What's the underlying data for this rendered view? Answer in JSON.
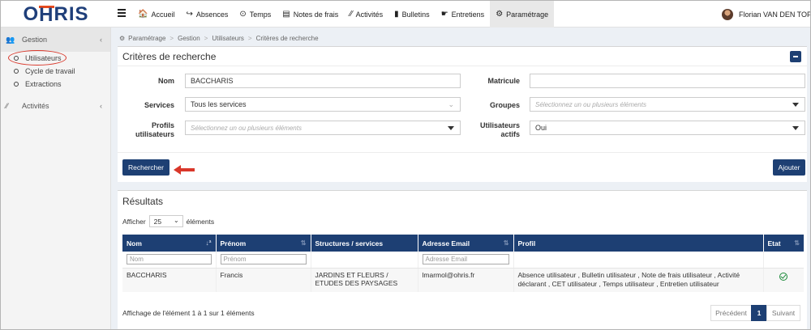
{
  "logo": {
    "part1": "O",
    "part2": "H",
    "part3": "RIS"
  },
  "nav": [
    {
      "icon": "🏠",
      "label": "Accueil"
    },
    {
      "icon": "↪",
      "label": "Absences"
    },
    {
      "icon": "⊙",
      "label": "Temps"
    },
    {
      "icon": "▤",
      "label": "Notes de frais"
    },
    {
      "icon": "⁄⁄",
      "label": "Activités"
    },
    {
      "icon": "▮",
      "label": "Bulletins"
    },
    {
      "icon": "☛",
      "label": "Entretiens"
    },
    {
      "icon": "⚙",
      "label": "Paramétrage"
    }
  ],
  "user": {
    "name": "Florian VAN DEN TOP"
  },
  "sidebar": {
    "gestion": "Gestion",
    "items": [
      "Utilisateurs",
      "Cycle de travail",
      "Extractions"
    ],
    "activites": "Activités"
  },
  "breadcrumb": [
    "Paramétrage",
    "Gestion",
    "Utilisateurs",
    "Critères de recherche"
  ],
  "search": {
    "title": "Critères de recherche",
    "nom_label": "Nom",
    "nom_value": "BACCHARIS",
    "matricule_label": "Matricule",
    "matricule_value": "",
    "services_label": "Services",
    "services_value": "Tous les services",
    "groupes_label": "Groupes",
    "groupes_placeholder": "Sélectionnez un ou plusieurs éléments",
    "profils_label_1": "Profils",
    "profils_label_2": "utilisateurs",
    "profils_placeholder": "Sélectionnez un ou plusieurs éléments",
    "actifs_label_1": "Utilisateurs",
    "actifs_label_2": "actifs",
    "actifs_value": "Oui",
    "search_button": "Rechercher",
    "add_button": "Ajouter"
  },
  "results": {
    "title": "Résultats",
    "show_prefix": "Afficher",
    "page_size": "25",
    "show_suffix": "éléments",
    "columns": [
      "Nom",
      "Prénom",
      "Structures / services",
      "Adresse Email",
      "Profil",
      "Etat"
    ],
    "filters": {
      "nom": "Nom",
      "prenom": "Prénom",
      "email": "Adresse Email"
    },
    "rows": [
      {
        "nom": "BACCHARIS",
        "prenom": "Francis",
        "structure_1": "JARDINS ET FLEURS /",
        "structure_2": "ETUDES DES PAYSAGES",
        "email": "lmarmol@ohris.fr",
        "profil_1": "Absence utilisateur ,  Bulletin utilisateur ,  Note de frais utilisateur ,  Activité",
        "profil_2": "déclarant ,  CET utilisateur ,  Temps utilisateur ,  Entretien utilisateur",
        "etat": "active"
      }
    ],
    "summary": "Affichage de l'élément 1 à  1 sur 1 éléments",
    "pager": {
      "prev": "Précédent",
      "page": "1",
      "next": "Suivant"
    }
  },
  "colors": {
    "primary": "#1d3f73",
    "accent": "#e64a1e",
    "annotation": "#d9372a",
    "success": "#1c8a3a"
  }
}
